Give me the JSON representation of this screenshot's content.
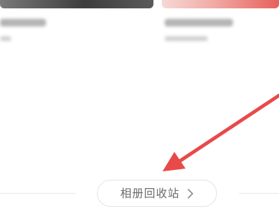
{
  "album_grid": {
    "albums": [
      {
        "thumbnail": "dark-photo"
      },
      {
        "thumbnail": "pink-photo"
      }
    ]
  },
  "recycle_bin": {
    "label": "相册回收站",
    "icon": "chevron-right-icon"
  },
  "annotation": {
    "color": "#e84a4a"
  }
}
